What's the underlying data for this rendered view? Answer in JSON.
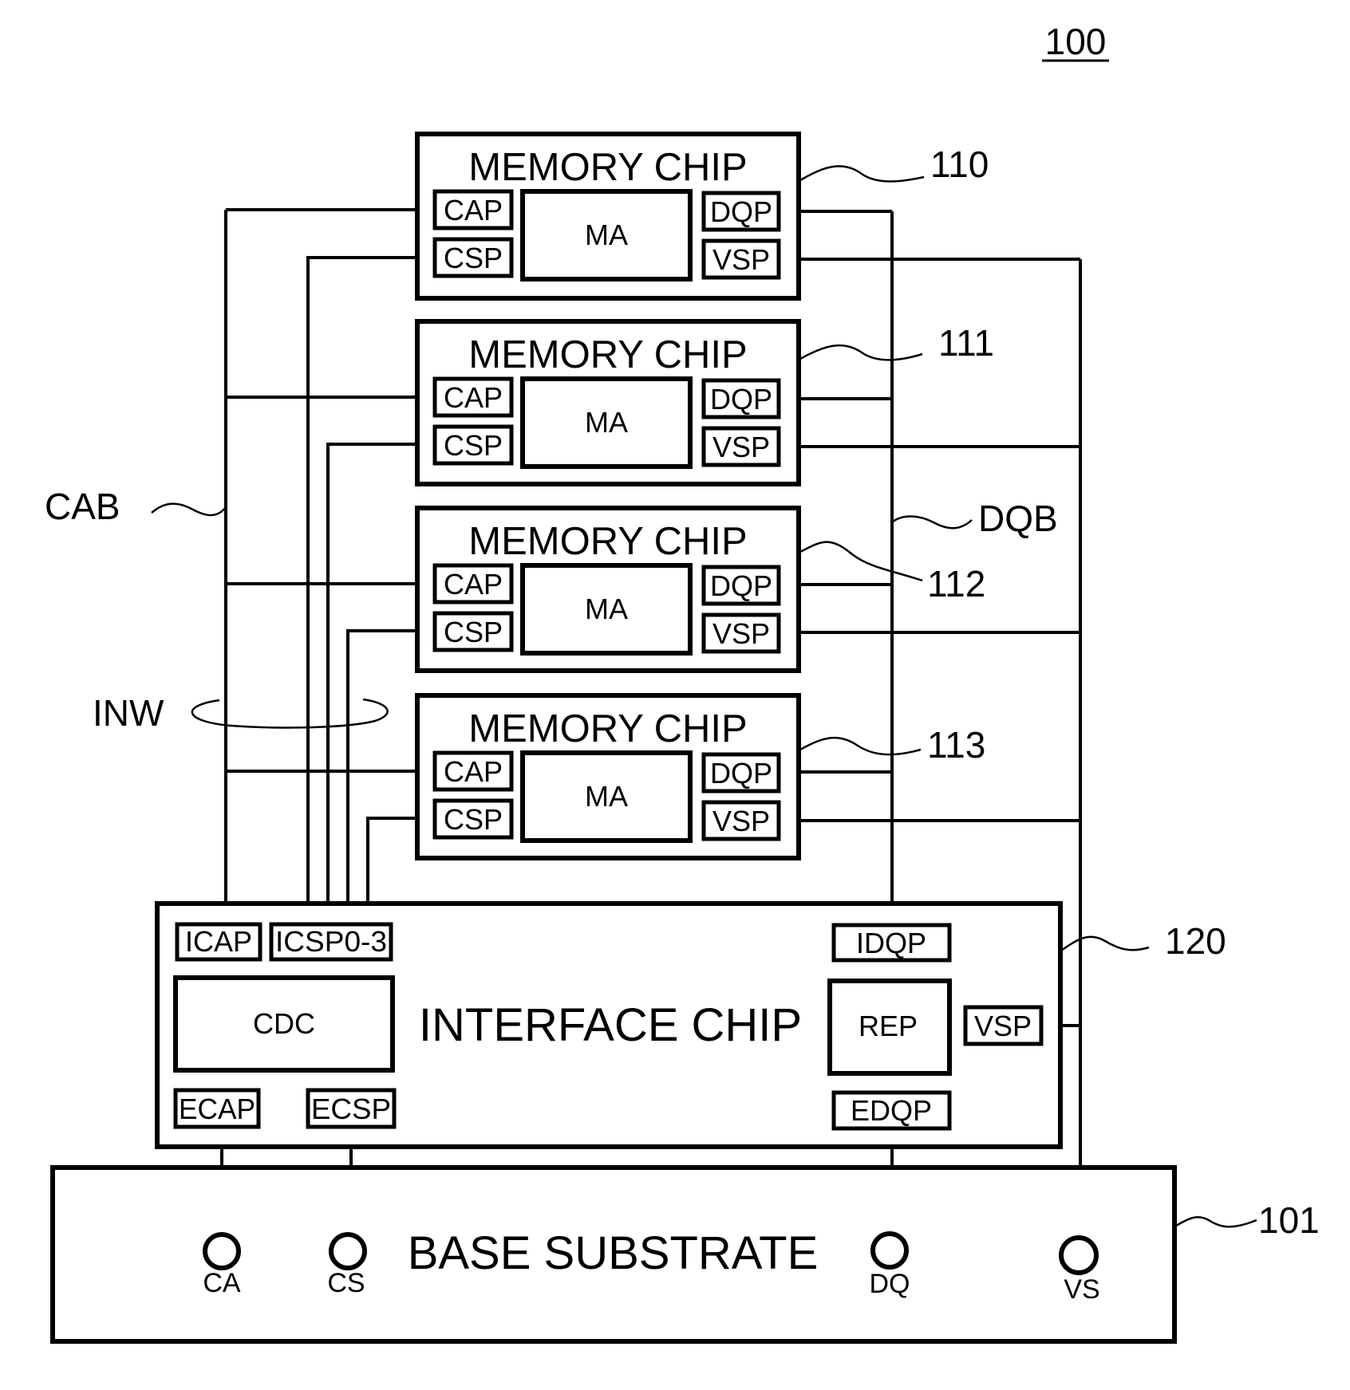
{
  "figure_ref": "100",
  "labels": {
    "cab": "CAB",
    "dqb": "DQB",
    "inw": "INW"
  },
  "memory_chips": [
    {
      "ref": "110",
      "title": "MEMORY CHIP",
      "array": "MA",
      "pads": {
        "ca": "CAP",
        "cs": "CSP",
        "dq": "DQP",
        "vs": "VSP"
      }
    },
    {
      "ref": "111",
      "title": "MEMORY CHIP",
      "array": "MA",
      "pads": {
        "ca": "CAP",
        "cs": "CSP",
        "dq": "DQP",
        "vs": "VSP"
      }
    },
    {
      "ref": "112",
      "title": "MEMORY CHIP",
      "array": "MA",
      "pads": {
        "ca": "CAP",
        "cs": "CSP",
        "dq": "DQP",
        "vs": "VSP"
      }
    },
    {
      "ref": "113",
      "title": "MEMORY CHIP",
      "array": "MA",
      "pads": {
        "ca": "CAP",
        "cs": "CSP",
        "dq": "DQP",
        "vs": "VSP"
      }
    }
  ],
  "interface_chip": {
    "ref": "120",
    "title": "INTERFACE CHIP",
    "pads": {
      "icap": "ICAP",
      "icsp": "ICSP0-3",
      "idqp": "IDQP",
      "ecap": "ECAP",
      "ecsp": "ECSP",
      "edqp": "EDQP",
      "vsp": "VSP"
    },
    "blocks": {
      "cdc": "CDC",
      "rep": "REP"
    }
  },
  "base_substrate": {
    "ref": "101",
    "title": "BASE SUBSTRATE",
    "pins": [
      "CA",
      "CS",
      "DQ",
      "VS"
    ]
  }
}
